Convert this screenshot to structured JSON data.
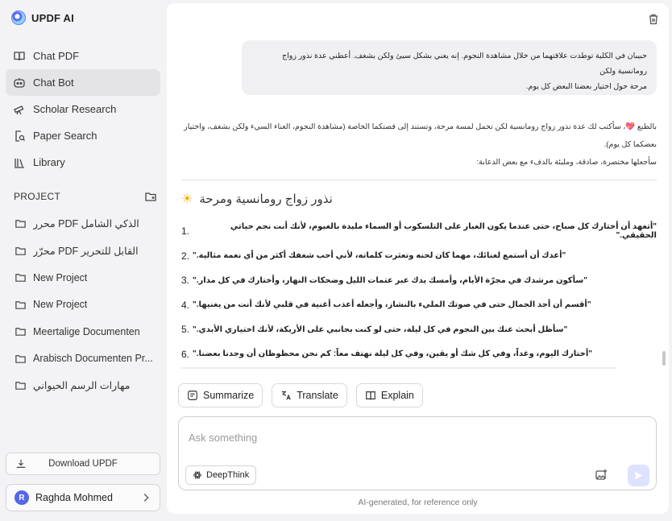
{
  "app": {
    "brand": "UPDF AI"
  },
  "nav": [
    {
      "label": "Chat PDF",
      "icon": "book-icon"
    },
    {
      "label": "Chat Bot",
      "icon": "chat-bot-icon",
      "active": true
    },
    {
      "label": "Scholar Research",
      "icon": "telescope-icon"
    },
    {
      "label": "Paper Search",
      "icon": "document-search-icon"
    },
    {
      "label": "Library",
      "icon": "library-icon"
    }
  ],
  "projects": {
    "title": "PROJECT",
    "items": [
      "محرر PDF الذكي الشامل",
      "محرّر PDF القابل للتحرير",
      "New Project",
      "New Project",
      "Meertalige Documenten",
      "Arabisch Documenten Pr...",
      "مهارات الرسم الحيواني"
    ]
  },
  "download": {
    "label": "Download UPDF"
  },
  "user": {
    "initial": "R",
    "name": "Raghda Mohmed"
  },
  "chat": {
    "user_message_line1": "حبيبان في الكلية توطدت علاقتهما من خلال مشاهدة النجوم. إنه يغني بشكل سيئ ولكن بشغف. أعطني عدة نذور زواج رومانسية ولكن",
    "user_message_line2": "مرحة حول اختيار بعضنا البعض كل يوم.",
    "answer_intro_1": "بالطبع 💖، سأكتب لك عدة نذور زواج رومانسية لكن تحمل لمسة مرحة، وتستند إلى قصتكما الخاصة (مشاهدة النجوم، الغناء السيء ولكن بشغف، واختيار",
    "answer_intro_2": "بعضكما كل يوم).",
    "answer_intro_3": "سأجعلها مختصرة، صادقة، ومليئة بالدفء مع بعض الدعابة:",
    "heading": "نذور زواج رومانسية ومرحة",
    "vows": [
      {
        "num": "1.",
        "text": "\"أتعهد أن أختارك كل صباح، حتى عندما يكون الغبار على التلسكوب أو السماء مليدة بالغيوم، لأنك أنت نجم حياتي الحقيقي.\""
      },
      {
        "num": "2.",
        "text": "\"أعدك أن أستمع لغنائك، مهما كان لحنه وتعثرت كلماته، لأني أحب شغفك أكثر من أي نغمة مثالية.\""
      },
      {
        "num": "3.",
        "text": "\"سأكون مرشدك في مجرّة الأيام، وأمسك يدك عبر عتمات الليل وضحكات النهار، وأختارك في كل مدار.\""
      },
      {
        "num": "4.",
        "text": "\"أقسم أن أجد الجمال حتى في صوتك المليء بالنشاز، وأجعله أعذب أغنية في قلبي لأنك أنت من يغنيها.\""
      },
      {
        "num": "5.",
        "text": "\"سأظل أبحث عنك بين النجوم في كل ليلة، حتى لو كنت بجانبي على الأريكة، لأنك اختياري الأبدي.\""
      },
      {
        "num": "6.",
        "text": "\"أختارك اليوم، وغداً، وفي كل شك أو يقين، وفي كل ليلة نهتف معاً: كم نحن محظوظان أن وجدنا بعضنا.\""
      }
    ]
  },
  "actions": [
    {
      "label": "Summarize",
      "icon": "summarize-icon"
    },
    {
      "label": "Translate",
      "icon": "translate-icon"
    },
    {
      "label": "Explain",
      "icon": "explain-icon"
    }
  ],
  "composer": {
    "placeholder": "Ask something",
    "deepthink_label": "DeepThink"
  },
  "disclaimer": "AI-generated, for reference only"
}
